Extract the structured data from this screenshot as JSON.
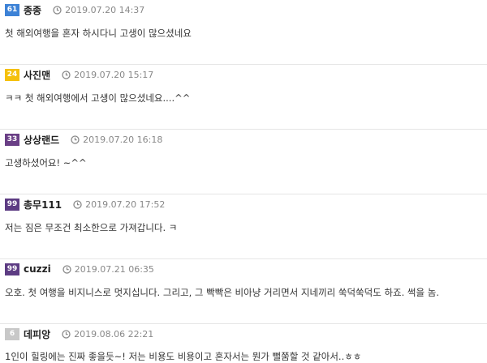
{
  "comments": [
    {
      "level": "61",
      "level_color": "#3d82d6",
      "nickname": "종종",
      "date": "2019.07.20 14:37",
      "text": "첫 해외여행을 혼자 하시다니 고생이 많으셨네요"
    },
    {
      "level": "24",
      "level_color": "#f5c00b",
      "nickname": "사진맨",
      "date": "2019.07.20 15:17",
      "text": "ㅋㅋ 첫 해외여행에서 고생이 많으셨네요....^^"
    },
    {
      "level": "33",
      "level_color": "#6a3f86",
      "nickname": "상상랜드",
      "date": "2019.07.20 16:18",
      "text": "고생하셨어요! ~^^"
    },
    {
      "level": "99",
      "level_color": "#5d3c83",
      "nickname": "총무111",
      "date": "2019.07.20 17:52",
      "text": "저는 짐은 무조건 최소한으로 가져갑니다. ㅋ"
    },
    {
      "level": "99",
      "level_color": "#5d3c83",
      "nickname": "cuzzi",
      "date": "2019.07.21 06:35",
      "text": "오호. 첫 여행을 비지니스로 멋지십니다. 그리고, 그 빡빡은 비아냥 거리면서 지네끼리 쑥덕쑥덕도 하죠. 썩을 놈."
    },
    {
      "level": "6",
      "level_color": "#c8c8c8",
      "nickname": "데피앙",
      "date": "2019.08.06 22:21",
      "text": "1인이 힐링에는 진짜 좋을듯~! 저는 비용도 비용이고 혼자서는 뭔가 뻘쭘할 것 같아서..ㅎㅎ"
    }
  ]
}
